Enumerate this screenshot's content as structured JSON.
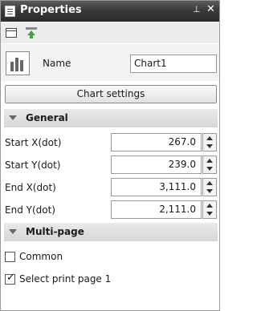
{
  "panel": {
    "title": "Properties",
    "pin_glyph": "⊥",
    "close_glyph": "✕"
  },
  "toolbar": {
    "icons": [
      "blank-page-icon",
      "green-up-arrow-icon"
    ]
  },
  "name_row": {
    "icon": "bar-chart-icon",
    "label": "Name",
    "value": "Chart1"
  },
  "chart_settings_label": "Chart settings",
  "general": {
    "title": "General",
    "rows": [
      {
        "label": "Start X(dot)",
        "value": "267.0"
      },
      {
        "label": "Start Y(dot)",
        "value": "239.0"
      },
      {
        "label": "End X(dot)",
        "value": "3,111.0"
      },
      {
        "label": "End Y(dot)",
        "value": "2,111.0"
      }
    ]
  },
  "multipage": {
    "title": "Multi-page",
    "options": [
      {
        "label": "Common",
        "checked": false
      },
      {
        "label": "Select print page 1",
        "checked": true
      }
    ]
  }
}
